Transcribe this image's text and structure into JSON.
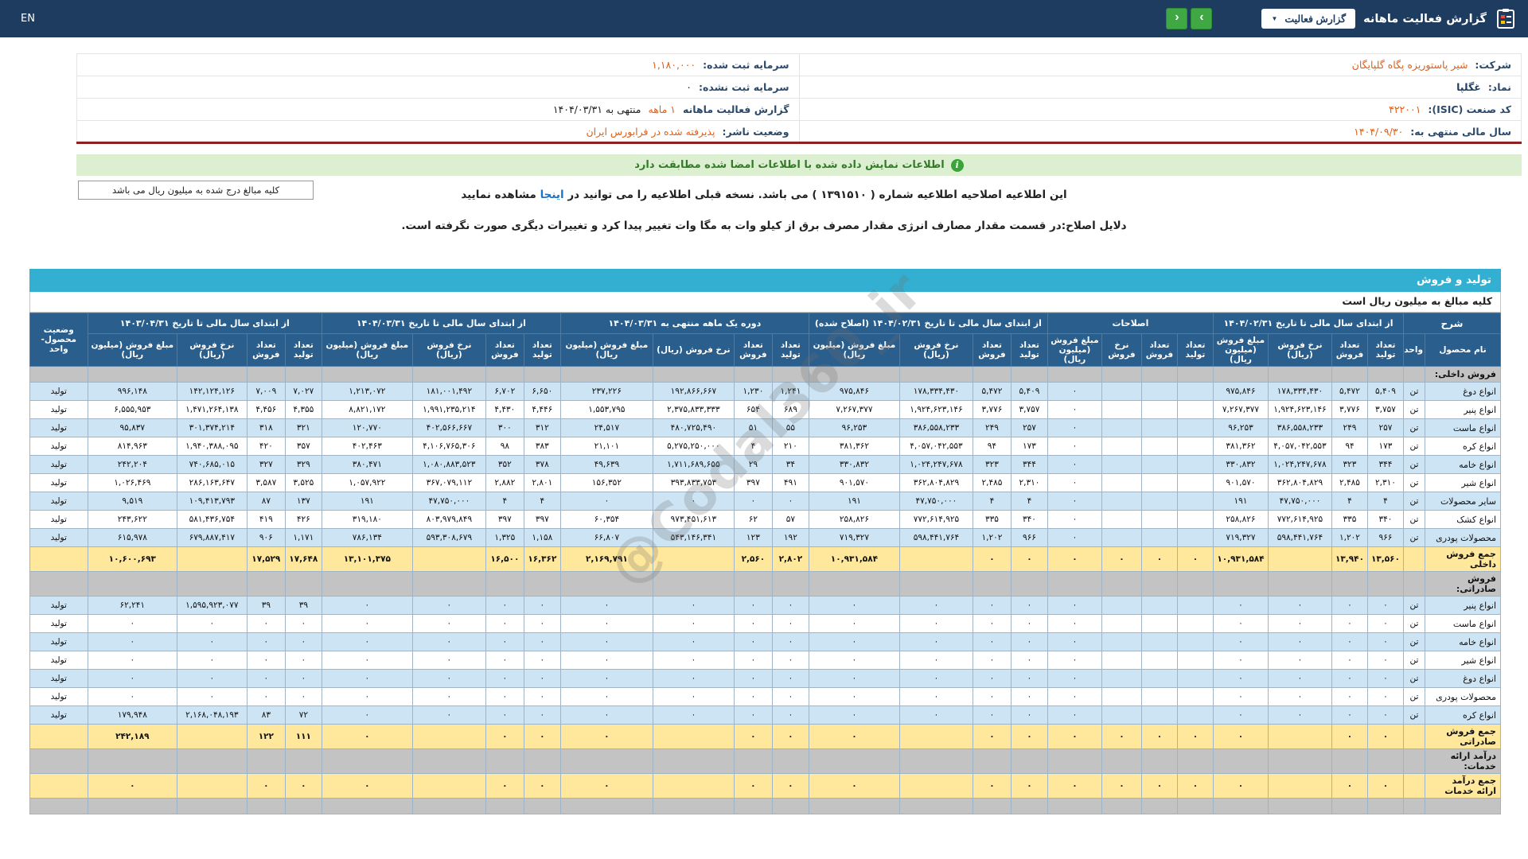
{
  "colors": {
    "topbar_navy": "#1E3C5F",
    "header_blue": "#2A5E8C",
    "header_border": "#4F7BA3",
    "grid_border": "#9FB4C6",
    "bar_cyan": "#33AFD1",
    "zebra_blue": "#CDE4F4",
    "sum_yellow": "#FFE79B",
    "section_gray": "#C3C3C3",
    "accent_orange": "#E0601A",
    "banner_bg": "#DCEFD0",
    "banner_text": "#357A2B",
    "maroon_line": "#8A2020",
    "link_blue": "#1A74C9",
    "nav_green": "#3FA845"
  },
  "topbar": {
    "title": "گزارش فعالیت ماهانه",
    "dropdown_label": "گزارش فعالیت",
    "caret": "▼",
    "nav_prev": "‹",
    "nav_next": "›",
    "lang_toggle": "EN"
  },
  "company_info": {
    "rows": [
      {
        "right_label": "شرکت:",
        "right_value": "شیر پاستوریزه پگاه گلپایگان",
        "left_label": "سرمایه ثبت شده:",
        "left_value": "۱,۱۸۰,۰۰۰"
      },
      {
        "right_label": "نماد:",
        "right_value": "غگلپا",
        "left_label": "سرمایه ثبت نشده:",
        "left_value": "۰"
      },
      {
        "right_label": "کد صنعت (ISIC):",
        "right_value": "۴۲۲۰۰۱",
        "left_label": "گزارش فعالیت ماهانه",
        "left_highlight": "۱ ماهه",
        "left_suffix": "منتهی به ۱۴۰۴/۰۳/۳۱"
      },
      {
        "right_label": "سال مالی منتهی به:",
        "right_value": "۱۴۰۴/۰۹/۳۰",
        "left_label": "وضعیت ناشر:",
        "left_value": "پذیرفته شده در فرابورس ایران"
      }
    ]
  },
  "banner": {
    "text": "اطلاعات نمایش داده شده با اطلاعات امضا شده مطابقت دارد",
    "icon": "i"
  },
  "notes": {
    "amounts_box": "کلیه مبالغ درج شده به میلیون ریال می باشد",
    "revision_pre": "این اطلاعیه اصلاحیه اطلاعیه شماره ( ۱۳۹۱۵۱۰ ) می باشد. نسخه قبلی اطلاعیه را می توانید در",
    "revision_link": "اینجا",
    "revision_post": "مشاهده نمایید",
    "reason": "دلایل اصلاح:در قسمت مقدار مصارف انرژی مقدار مصرف برق از کیلو وات به مگا وات تغییر پیدا کرد و تغییرات دیگری صورت نگرفته است."
  },
  "section": {
    "title": "تولید و فروش",
    "amounts_note": "کلیه مبالغ به میلیون ریال است"
  },
  "watermark": "@Codal360_ir",
  "table": {
    "sharh_header": "شرح",
    "name_header": "نام محصول",
    "unit_header": "واحد",
    "status_header": "وضعیت محصول-واحد",
    "col_labels": {
      "tolid": "تعداد تولید",
      "forush": "تعداد فروش",
      "nerkh": "نرخ فروش (ریال)",
      "nerkh_short": "نرخ فروش",
      "mablagh": "مبلغ فروش (میلیون ریال)"
    },
    "groups": [
      {
        "title": "از ابتدای سال مالی تا تاریخ ۱۴۰۴/۰۲/۳۱"
      },
      {
        "title": "اصلاحات"
      },
      {
        "title": "از ابتدای سال مالی تا تاریخ ۱۴۰۴/۰۲/۳۱ (اصلاح شده)"
      },
      {
        "title": "دوره یک ماهه منتهی به ۱۴۰۴/۰۳/۳۱"
      },
      {
        "title": "از ابتدای سال مالی تا تاریخ ۱۴۰۴/۰۳/۳۱"
      },
      {
        "title": "از ابتدای سال مالی تا تاریخ ۱۴۰۳/۰۴/۳۱"
      }
    ],
    "rows": [
      {
        "type": "section",
        "name": "فروش داخلی:"
      },
      {
        "type": "data",
        "name": "انواع دوغ",
        "unit": "تن",
        "status": "تولید",
        "cells": [
          [
            "۵,۴۰۹",
            "۵,۴۷۲",
            "۱۷۸,۳۳۴,۴۳۰",
            "۹۷۵,۸۴۶"
          ],
          [
            "",
            "",
            "",
            "۰"
          ],
          [
            "۵,۴۰۹",
            "۵,۴۷۲",
            "۱۷۸,۳۳۴,۴۳۰",
            "۹۷۵,۸۴۶"
          ],
          [
            "۱,۲۴۱",
            "۱,۲۳۰",
            "۱۹۲,۸۶۶,۶۶۷",
            "۲۳۷,۲۲۶"
          ],
          [
            "۶,۶۵۰",
            "۶,۷۰۲",
            "۱۸۱,۰۰۱,۴۹۲",
            "۱,۲۱۳,۰۷۲"
          ],
          [
            "۷,۰۲۷",
            "۷,۰۰۹",
            "۱۴۲,۱۲۴,۱۲۶",
            "۹۹۶,۱۴۸"
          ]
        ]
      },
      {
        "type": "data",
        "name": "انواع پنیر",
        "unit": "تن",
        "status": "تولید",
        "cells": [
          [
            "۳,۷۵۷",
            "۳,۷۷۶",
            "۱,۹۲۴,۶۲۳,۱۴۶",
            "۷,۲۶۷,۳۷۷"
          ],
          [
            "",
            "",
            "",
            "۰"
          ],
          [
            "۳,۷۵۷",
            "۳,۷۷۶",
            "۱,۹۲۴,۶۲۳,۱۴۶",
            "۷,۲۶۷,۳۷۷"
          ],
          [
            "۶۸۹",
            "۶۵۴",
            "۲,۳۷۵,۸۳۳,۳۳۳",
            "۱,۵۵۳,۷۹۵"
          ],
          [
            "۴,۴۴۶",
            "۴,۴۳۰",
            "۱,۹۹۱,۲۳۵,۲۱۴",
            "۸,۸۲۱,۱۷۲"
          ],
          [
            "۴,۳۵۵",
            "۴,۴۵۶",
            "۱,۴۷۱,۲۶۴,۱۳۸",
            "۶,۵۵۵,۹۵۳"
          ]
        ]
      },
      {
        "type": "data",
        "name": "انواع ماست",
        "unit": "تن",
        "status": "تولید",
        "cells": [
          [
            "۲۵۷",
            "۲۴۹",
            "۳۸۶,۵۵۸,۲۳۳",
            "۹۶,۲۵۳"
          ],
          [
            "",
            "",
            "",
            "۰"
          ],
          [
            "۲۵۷",
            "۲۴۹",
            "۳۸۶,۵۵۸,۲۳۳",
            "۹۶,۲۵۳"
          ],
          [
            "۵۵",
            "۵۱",
            "۴۸۰,۷۲۵,۴۹۰",
            "۲۴,۵۱۷"
          ],
          [
            "۳۱۲",
            "۳۰۰",
            "۴۰۲,۵۶۶,۶۶۷",
            "۱۲۰,۷۷۰"
          ],
          [
            "۳۲۱",
            "۳۱۸",
            "۳۰۱,۳۷۴,۲۱۴",
            "۹۵,۸۳۷"
          ]
        ]
      },
      {
        "type": "data",
        "name": "انواع کره",
        "unit": "تن",
        "status": "تولید",
        "cells": [
          [
            "۱۷۳",
            "۹۴",
            "۴,۰۵۷,۰۴۲,۵۵۳",
            "۳۸۱,۳۶۲"
          ],
          [
            "",
            "",
            "",
            "۰"
          ],
          [
            "۱۷۳",
            "۹۴",
            "۴,۰۵۷,۰۴۲,۵۵۳",
            "۳۸۱,۳۶۲"
          ],
          [
            "۲۱۰",
            "۴",
            "۵,۲۷۵,۲۵۰,۰۰۰",
            "۲۱,۱۰۱"
          ],
          [
            "۳۸۳",
            "۹۸",
            "۴,۱۰۶,۷۶۵,۳۰۶",
            "۴۰۲,۴۶۳"
          ],
          [
            "۳۵۷",
            "۴۲۰",
            "۱,۹۴۰,۳۸۸,۰۹۵",
            "۸۱۴,۹۶۳"
          ]
        ]
      },
      {
        "type": "data",
        "name": "انواع خامه",
        "unit": "تن",
        "status": "تولید",
        "cells": [
          [
            "۳۴۴",
            "۳۲۳",
            "۱,۰۲۴,۲۴۷,۶۷۸",
            "۳۳۰,۸۳۲"
          ],
          [
            "",
            "",
            "",
            "۰"
          ],
          [
            "۳۴۴",
            "۳۲۳",
            "۱,۰۲۴,۲۴۷,۶۷۸",
            "۳۳۰,۸۳۲"
          ],
          [
            "۳۴",
            "۲۹",
            "۱,۷۱۱,۶۸۹,۶۵۵",
            "۴۹,۶۳۹"
          ],
          [
            "۳۷۸",
            "۳۵۲",
            "۱,۰۸۰,۸۸۳,۵۲۳",
            "۳۸۰,۴۷۱"
          ],
          [
            "۳۲۹",
            "۳۲۷",
            "۷۴۰,۶۸۵,۰۱۵",
            "۲۴۲,۲۰۴"
          ]
        ]
      },
      {
        "type": "data",
        "name": "انواع شیر",
        "unit": "تن",
        "status": "تولید",
        "cells": [
          [
            "۲,۳۱۰",
            "۲,۴۸۵",
            "۳۶۲,۸۰۴,۸۲۹",
            "۹۰۱,۵۷۰"
          ],
          [
            "",
            "",
            "",
            "۰"
          ],
          [
            "۲,۳۱۰",
            "۲,۴۸۵",
            "۳۶۲,۸۰۴,۸۲۹",
            "۹۰۱,۵۷۰"
          ],
          [
            "۴۹۱",
            "۳۹۷",
            "۳۹۳,۸۳۳,۷۵۳",
            "۱۵۶,۳۵۲"
          ],
          [
            "۲,۸۰۱",
            "۲,۸۸۲",
            "۳۶۷,۰۷۹,۱۱۲",
            "۱,۰۵۷,۹۲۲"
          ],
          [
            "۳,۵۲۵",
            "۳,۵۸۷",
            "۲۸۶,۱۶۳,۶۴۷",
            "۱,۰۲۶,۴۶۹"
          ]
        ]
      },
      {
        "type": "data",
        "name": "سایر محصولات",
        "unit": "تن",
        "status": "تولید",
        "cells": [
          [
            "۴",
            "۴",
            "۴۷,۷۵۰,۰۰۰",
            "۱۹۱"
          ],
          [
            "",
            "",
            "",
            "۰"
          ],
          [
            "۴",
            "۴",
            "۴۷,۷۵۰,۰۰۰",
            "۱۹۱"
          ],
          [
            "۰",
            "۰",
            "۰",
            "۰"
          ],
          [
            "۴",
            "۴",
            "۴۷,۷۵۰,۰۰۰",
            "۱۹۱"
          ],
          [
            "۱۳۷",
            "۸۷",
            "۱۰۹,۴۱۳,۷۹۳",
            "۹,۵۱۹"
          ]
        ]
      },
      {
        "type": "data",
        "name": "انواع کشک",
        "unit": "تن",
        "status": "تولید",
        "cells": [
          [
            "۳۴۰",
            "۳۳۵",
            "۷۷۲,۶۱۴,۹۲۵",
            "۲۵۸,۸۲۶"
          ],
          [
            "",
            "",
            "",
            "۰"
          ],
          [
            "۳۴۰",
            "۳۳۵",
            "۷۷۲,۶۱۴,۹۲۵",
            "۲۵۸,۸۲۶"
          ],
          [
            "۵۷",
            "۶۲",
            "۹۷۳,۴۵۱,۶۱۳",
            "۶۰,۳۵۴"
          ],
          [
            "۳۹۷",
            "۳۹۷",
            "۸۰۳,۹۷۹,۸۴۹",
            "۳۱۹,۱۸۰"
          ],
          [
            "۴۲۶",
            "۴۱۹",
            "۵۸۱,۴۳۶,۷۵۴",
            "۲۴۳,۶۲۲"
          ]
        ]
      },
      {
        "type": "data",
        "name": "محصولات پودری",
        "unit": "تن",
        "status": "تولید",
        "cells": [
          [
            "۹۶۶",
            "۱,۲۰۲",
            "۵۹۸,۴۴۱,۷۶۴",
            "۷۱۹,۳۲۷"
          ],
          [
            "",
            "",
            "",
            "۰"
          ],
          [
            "۹۶۶",
            "۱,۲۰۲",
            "۵۹۸,۴۴۱,۷۶۴",
            "۷۱۹,۳۲۷"
          ],
          [
            "۱۹۲",
            "۱۲۳",
            "۵۴۳,۱۴۶,۳۴۱",
            "۶۶,۸۰۷"
          ],
          [
            "۱,۱۵۸",
            "۱,۳۲۵",
            "۵۹۳,۳۰۸,۶۷۹",
            "۷۸۶,۱۳۴"
          ],
          [
            "۱,۱۷۱",
            "۹۰۶",
            "۶۷۹,۸۸۷,۴۱۷",
            "۶۱۵,۹۷۸"
          ]
        ]
      },
      {
        "type": "sum",
        "name": "جمع فروش داخلی",
        "cells": [
          [
            "۱۳,۵۶۰",
            "۱۳,۹۴۰",
            "",
            "۱۰,۹۳۱,۵۸۴"
          ],
          [
            "۰",
            "۰",
            "۰",
            "۰"
          ],
          [
            "۰",
            "۰",
            "",
            "۱۰,۹۳۱,۵۸۴"
          ],
          [
            "۲,۸۰۲",
            "۲,۵۶۰",
            "",
            "۲,۱۶۹,۷۹۱"
          ],
          [
            "۱۶,۳۶۲",
            "۱۶,۵۰۰",
            "",
            "۱۳,۱۰۱,۳۷۵"
          ],
          [
            "۱۷,۶۴۸",
            "۱۷,۵۲۹",
            "",
            "۱۰,۶۰۰,۶۹۳"
          ]
        ]
      },
      {
        "type": "section",
        "name": "فروش صادراتی:"
      },
      {
        "type": "data",
        "name": "انواع پنیر",
        "unit": "تن",
        "status": "تولید",
        "cells": [
          [
            "۰",
            "۰",
            "۰",
            "۰"
          ],
          [
            "",
            "",
            "",
            "۰"
          ],
          [
            "۰",
            "۰",
            "۰",
            "۰"
          ],
          [
            "۰",
            "۰",
            "۰",
            "۰"
          ],
          [
            "۰",
            "۰",
            "۰",
            "۰"
          ],
          [
            "۳۹",
            "۳۹",
            "۱,۵۹۵,۹۲۳,۰۷۷",
            "۶۲,۲۴۱"
          ]
        ]
      },
      {
        "type": "data",
        "name": "انواع ماست",
        "unit": "تن",
        "status": "تولید",
        "cells": [
          [
            "۰",
            "۰",
            "۰",
            "۰"
          ],
          [
            "",
            "",
            "",
            "۰"
          ],
          [
            "۰",
            "۰",
            "۰",
            "۰"
          ],
          [
            "۰",
            "۰",
            "۰",
            "۰"
          ],
          [
            "۰",
            "۰",
            "۰",
            "۰"
          ],
          [
            "۰",
            "۰",
            "۰",
            "۰"
          ]
        ]
      },
      {
        "type": "data",
        "name": "انواع خامه",
        "unit": "تن",
        "status": "تولید",
        "cells": [
          [
            "۰",
            "۰",
            "۰",
            "۰"
          ],
          [
            "",
            "",
            "",
            "۰"
          ],
          [
            "۰",
            "۰",
            "۰",
            "۰"
          ],
          [
            "۰",
            "۰",
            "۰",
            "۰"
          ],
          [
            "۰",
            "۰",
            "۰",
            "۰"
          ],
          [
            "۰",
            "۰",
            "۰",
            "۰"
          ]
        ]
      },
      {
        "type": "data",
        "name": "انواع شیر",
        "unit": "تن",
        "status": "تولید",
        "cells": [
          [
            "۰",
            "۰",
            "۰",
            "۰"
          ],
          [
            "",
            "",
            "",
            "۰"
          ],
          [
            "۰",
            "۰",
            "۰",
            "۰"
          ],
          [
            "۰",
            "۰",
            "۰",
            "۰"
          ],
          [
            "۰",
            "۰",
            "۰",
            "۰"
          ],
          [
            "۰",
            "۰",
            "۰",
            "۰"
          ]
        ]
      },
      {
        "type": "data",
        "name": "انواع دوغ",
        "unit": "تن",
        "status": "تولید",
        "cells": [
          [
            "۰",
            "۰",
            "۰",
            "۰"
          ],
          [
            "",
            "",
            "",
            "۰"
          ],
          [
            "۰",
            "۰",
            "۰",
            "۰"
          ],
          [
            "۰",
            "۰",
            "۰",
            "۰"
          ],
          [
            "۰",
            "۰",
            "۰",
            "۰"
          ],
          [
            "۰",
            "۰",
            "۰",
            "۰"
          ]
        ]
      },
      {
        "type": "data",
        "name": "محصولات پودری",
        "unit": "تن",
        "status": "تولید",
        "cells": [
          [
            "۰",
            "۰",
            "۰",
            "۰"
          ],
          [
            "",
            "",
            "",
            "۰"
          ],
          [
            "۰",
            "۰",
            "۰",
            "۰"
          ],
          [
            "۰",
            "۰",
            "۰",
            "۰"
          ],
          [
            "۰",
            "۰",
            "۰",
            "۰"
          ],
          [
            "۰",
            "۰",
            "۰",
            "۰"
          ]
        ]
      },
      {
        "type": "data",
        "name": "انواع کره",
        "unit": "تن",
        "status": "تولید",
        "cells": [
          [
            "۰",
            "۰",
            "۰",
            "۰"
          ],
          [
            "",
            "",
            "",
            "۰"
          ],
          [
            "۰",
            "۰",
            "۰",
            "۰"
          ],
          [
            "۰",
            "۰",
            "۰",
            "۰"
          ],
          [
            "۰",
            "۰",
            "۰",
            "۰"
          ],
          [
            "۷۲",
            "۸۳",
            "۲,۱۶۸,۰۴۸,۱۹۳",
            "۱۷۹,۹۴۸"
          ]
        ]
      },
      {
        "type": "sum",
        "name": "جمع فروش صادراتی",
        "cells": [
          [
            "۰",
            "۰",
            "",
            "۰"
          ],
          [
            "۰",
            "۰",
            "۰",
            "۰"
          ],
          [
            "۰",
            "۰",
            "",
            "۰"
          ],
          [
            "۰",
            "۰",
            "",
            "۰"
          ],
          [
            "۰",
            "۰",
            "",
            "۰"
          ],
          [
            "۱۱۱",
            "۱۲۲",
            "",
            "۲۴۲,۱۸۹"
          ]
        ]
      },
      {
        "type": "section",
        "name": "درآمد ارائه خدمات:"
      },
      {
        "type": "sum",
        "name": "جمع درآمد ارائه خدمات",
        "cells": [
          [
            "۰",
            "۰",
            "",
            "۰"
          ],
          [
            "۰",
            "۰",
            "۰",
            "۰"
          ],
          [
            "۰",
            "۰",
            "",
            "۰"
          ],
          [
            "۰",
            "۰",
            "",
            "۰"
          ],
          [
            "۰",
            "۰",
            "",
            "۰"
          ],
          [
            "۰",
            "۰",
            "",
            "۰"
          ]
        ]
      },
      {
        "type": "section",
        "name": ""
      }
    ]
  }
}
